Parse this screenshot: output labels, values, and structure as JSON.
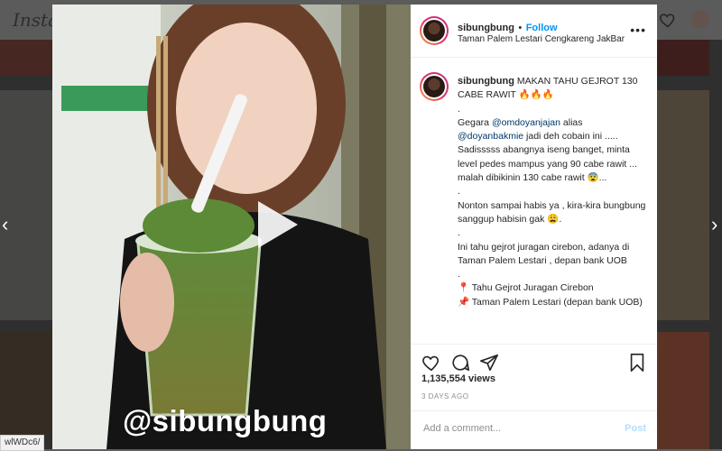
{
  "app": {
    "logo_text": "Insta"
  },
  "browser": {
    "url_hint": "wlWDc6/"
  },
  "post": {
    "username": "sibungbung",
    "follow_label": "Follow",
    "separator": "•",
    "location": "Taman Palem Lestari Cengkareng JakBar",
    "more_label": "•••",
    "caption_lines": [
      {
        "type": "text",
        "text": "MAKAN TAHU GEJROT 130 CABE RAWIT 🔥🔥🔥"
      }
    ],
    "caption_body_1": ".",
    "caption_gegara": "Gegara ",
    "mention1": "@omdoyanjajan",
    "caption_alias": " alias ",
    "mention2": "@doyanbakmie",
    "caption_rest": " jadi deh cobain ini ..... Sadisssss abangnya iseng banget, minta level pedes mampus yang 90 cabe rawit ... malah dibikinin 130 cabe rawit 😨...\n.\nNonton sampai habis ya , kira-kira bungbung sanggup habisin gak 😩.\n.\nIni tahu gejrot juragan cirebon, adanya di Taman Palem Lestari , depan bank UOB\n.\n📍 Tahu Gejrot Juragan Cirebon\n📌 Taman Palem Lestari (depan bank UOB)",
    "views": "1,135,554 views",
    "time_ago": "3 DAYS AGO",
    "comment_placeholder": "Add a comment...",
    "post_label": "Post",
    "watermark": "@sibungbung"
  },
  "colors": {
    "follow": "#0095f6",
    "post_disabled": "#b2dffc",
    "mention": "#00376b"
  },
  "icons": [
    "heart-icon",
    "comment-icon",
    "share-icon",
    "bookmark-icon",
    "play-icon",
    "more-icon"
  ]
}
